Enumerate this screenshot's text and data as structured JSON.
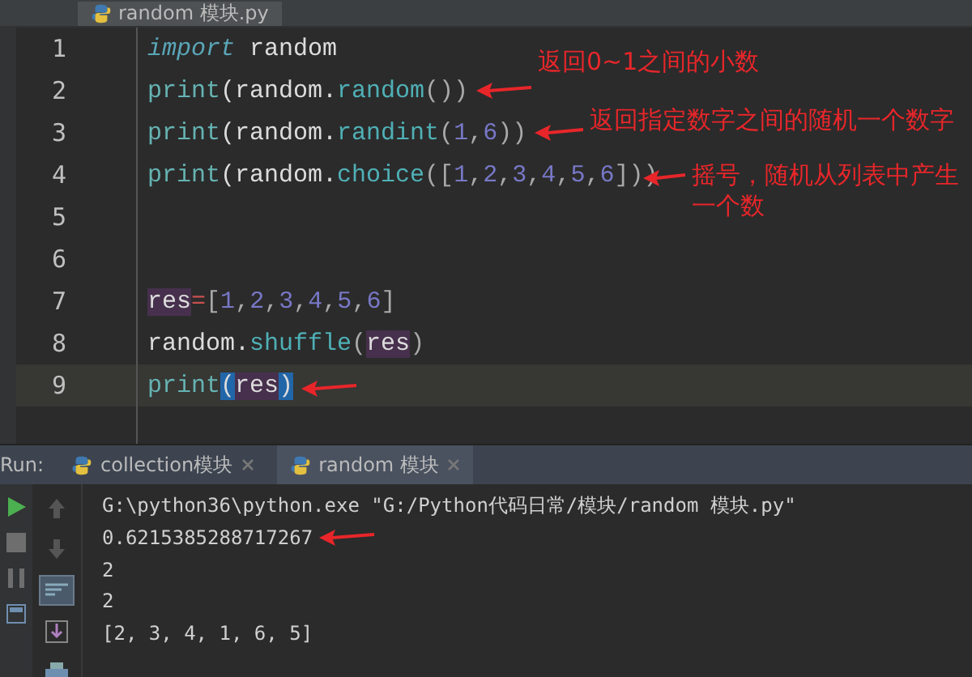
{
  "editor_tab": {
    "title": "random 模块.py"
  },
  "editor": {
    "lines": [
      {
        "number": "1",
        "current": false,
        "tokens": [
          {
            "text": "import",
            "kind": "keyword"
          },
          {
            "text": " random",
            "kind": "name"
          }
        ]
      },
      {
        "number": "2",
        "current": false,
        "tokens": [
          {
            "text": "print",
            "kind": "builtin"
          },
          {
            "text": "(random.",
            "kind": "name"
          },
          {
            "text": "random",
            "kind": "call"
          },
          {
            "text": "())",
            "kind": "punct"
          }
        ]
      },
      {
        "number": "3",
        "current": false,
        "tokens": [
          {
            "text": "print",
            "kind": "builtin"
          },
          {
            "text": "(random.",
            "kind": "name"
          },
          {
            "text": "randint",
            "kind": "call"
          },
          {
            "text": "(",
            "kind": "punct"
          },
          {
            "text": "1",
            "kind": "number"
          },
          {
            "text": ",",
            "kind": "punct"
          },
          {
            "text": "6",
            "kind": "number"
          },
          {
            "text": "))",
            "kind": "punct"
          }
        ]
      },
      {
        "number": "4",
        "current": false,
        "tokens": [
          {
            "text": "print",
            "kind": "builtin"
          },
          {
            "text": "(random.",
            "kind": "name"
          },
          {
            "text": "choice",
            "kind": "call"
          },
          {
            "text": "([",
            "kind": "punct"
          },
          {
            "text": "1",
            "kind": "number"
          },
          {
            "text": ",",
            "kind": "punct"
          },
          {
            "text": "2",
            "kind": "number"
          },
          {
            "text": ",",
            "kind": "punct"
          },
          {
            "text": "3",
            "kind": "number"
          },
          {
            "text": ",",
            "kind": "punct"
          },
          {
            "text": "4",
            "kind": "number"
          },
          {
            "text": ",",
            "kind": "punct"
          },
          {
            "text": "5",
            "kind": "number"
          },
          {
            "text": ",",
            "kind": "punct"
          },
          {
            "text": "6",
            "kind": "number"
          },
          {
            "text": "]))",
            "kind": "punct"
          }
        ]
      },
      {
        "number": "5",
        "current": false
      },
      {
        "number": "6",
        "current": false
      },
      {
        "number": "7",
        "current": false,
        "tokens": [
          {
            "text": "res",
            "kind": "usage"
          },
          {
            "text": "=",
            "kind": "operator"
          },
          {
            "text": "[",
            "kind": "punct"
          },
          {
            "text": "1",
            "kind": "number"
          },
          {
            "text": ",",
            "kind": "punct"
          },
          {
            "text": "2",
            "kind": "number"
          },
          {
            "text": ",",
            "kind": "punct"
          },
          {
            "text": "3",
            "kind": "number"
          },
          {
            "text": ",",
            "kind": "punct"
          },
          {
            "text": "4",
            "kind": "number"
          },
          {
            "text": ",",
            "kind": "punct"
          },
          {
            "text": "5",
            "kind": "number"
          },
          {
            "text": ",",
            "kind": "punct"
          },
          {
            "text": "6",
            "kind": "number"
          },
          {
            "text": "]",
            "kind": "punct"
          }
        ]
      },
      {
        "number": "8",
        "current": false,
        "tokens": [
          {
            "text": "random.",
            "kind": "name"
          },
          {
            "text": "shuffle",
            "kind": "call"
          },
          {
            "text": "(",
            "kind": "punct"
          },
          {
            "text": "res",
            "kind": "usage"
          },
          {
            "text": ")",
            "kind": "punct"
          }
        ]
      },
      {
        "number": "9",
        "current": true,
        "tokens": [
          {
            "text": "print",
            "kind": "builtin"
          },
          {
            "text": "(",
            "kind": "brace"
          },
          {
            "text": "res",
            "kind": "usage"
          },
          {
            "text": ")",
            "kind": "brace"
          }
        ]
      }
    ]
  },
  "annotations": [
    {
      "kind": "note",
      "text": "返回0~1之间的小数"
    },
    {
      "kind": "note",
      "text": "返回指定数字之间的随机一个数字"
    },
    {
      "kind": "note",
      "text": "摇号，随机从列表中产生一个数"
    },
    {
      "kind": "arrow"
    }
  ],
  "run_panel": {
    "label": "Run:",
    "tabs": [
      {
        "title": "collection模块",
        "selected": false
      },
      {
        "title": "random 模块",
        "selected": true
      }
    ],
    "console": [
      {
        "text": "G:\\python36\\python.exe \"G:/Python代码日常/模块/random 模块.py\"",
        "arrow": false
      },
      {
        "text": "0.6215385288717267",
        "arrow": true
      },
      {
        "text": "2",
        "arrow": false
      },
      {
        "text": "2",
        "arrow": false
      },
      {
        "text": "[2, 3, 4, 1, 6, 5]",
        "arrow": false
      }
    ]
  }
}
